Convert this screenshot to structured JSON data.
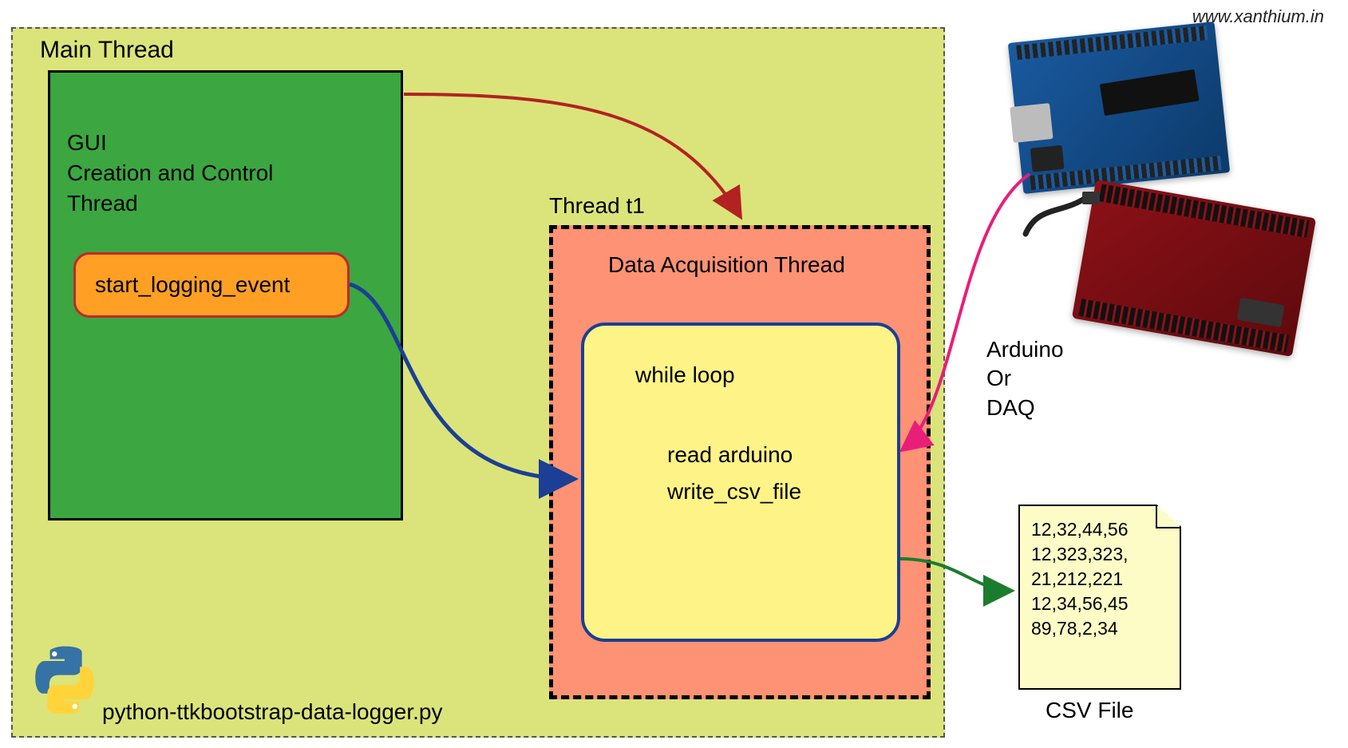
{
  "url": "www.xanthium.in",
  "mainThread": {
    "label": "Main Thread",
    "guiLine1": "GUI",
    "guiLine2": "Creation and Control",
    "guiLine3": "Thread",
    "eventButton": "start_logging_event"
  },
  "threadT1": {
    "label": "Thread t1",
    "title": "Data Acquisition Thread",
    "loopLabel": "while loop",
    "step1": "read arduino",
    "step2": "write_csv_file"
  },
  "scriptName": "python-ttkbootstrap-data-logger.py",
  "hardware": {
    "line1": "Arduino",
    "line2": "Or",
    "line3": "DAQ"
  },
  "csv": {
    "rows": [
      "12,32,44,56",
      "12,323,323,",
      "21,212,221",
      "12,34,56,45",
      "89,78,2,34"
    ],
    "label": "CSV File"
  }
}
